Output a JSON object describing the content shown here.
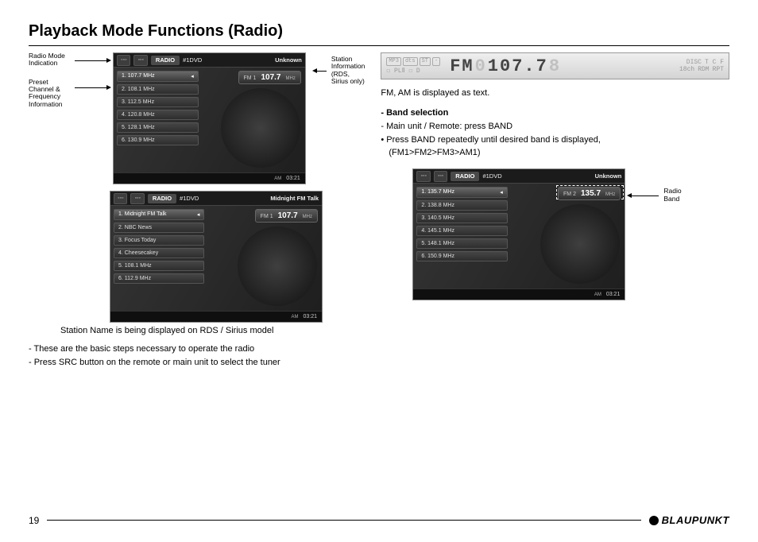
{
  "page_title": "Playback Mode Functions (Radio)",
  "page_number": "19",
  "brand": "BLAUPUNKT",
  "callouts": {
    "radio_mode": "Radio Mode Indication",
    "preset_freq": "Preset Channel & Frequency Information",
    "station_info": "Station Information (RDS, Sirius only)",
    "radio_band": "Radio Band"
  },
  "shot1": {
    "tab": "RADIO",
    "radio_src": "#1DVD",
    "station_name": "Unknown",
    "presets": [
      "1. 107.7 MHz",
      "2. 108.1 MHz",
      "3. 112.5 MHz",
      "4. 120.8 MHz",
      "5. 128.1 MHz",
      "6. 130.9 MHz"
    ],
    "band": "FM 1",
    "freq": "107.7",
    "unit": "MHz",
    "ampm": "AM",
    "clock": "03:21"
  },
  "shot2": {
    "tab": "RADIO",
    "radio_src": "#1DVD",
    "station_name": "Midnight FM Talk",
    "presets": [
      "1. Midnight FM Talk",
      "2. NBC News",
      "3. Focus Today",
      "4. Cheesecakey",
      "5. 108.1 MHz",
      "6. 112.9 MHz"
    ],
    "band": "FM 1",
    "freq": "107.7",
    "unit": "MHz",
    "ampm": "AM",
    "clock": "03:21"
  },
  "shot3": {
    "tab": "RADIO",
    "radio_src": "#1DVD",
    "station_name": "Unknown",
    "presets": [
      "1. 135.7 MHz",
      "2. 138.8 MHz",
      "3. 140.5 MHz",
      "4. 145.1 MHz",
      "5. 148.1 MHz",
      "6. 150.9 MHz"
    ],
    "band": "FM 2",
    "freq": "135.7",
    "unit": "MHz",
    "ampm": "AM",
    "clock": "03:21"
  },
  "lcd": {
    "tags_left": [
      "MP3",
      "dts",
      "ST",
      "-"
    ],
    "row2_left": "☐ PLⅡ   ☐ D",
    "band_text": "FM",
    "ghost_lead": "0",
    "freq": "107.7",
    "ghost_trail": "8",
    "disc": "DISC",
    "tcf": "T  C  F",
    "ch": "18ch",
    "rdm": "RDM",
    "rpt": "RPT"
  },
  "captions": {
    "rds": "Station Name is being displayed on RDS / Sirius model"
  },
  "body_left": {
    "l1": "- These are the basic steps necessary to operate the radio",
    "l2": "- Press SRC button on the remote or main unit to select the tuner"
  },
  "body_right": {
    "l1": "FM, AM is displayed as text.",
    "h1": "- Band selection",
    "l2": "- Main unit / Remote: press BAND",
    "l3": "• Press BAND repeatedly until desired band is displayed,",
    "l4": "  (FM1>FM2>FM3>AM1)"
  }
}
